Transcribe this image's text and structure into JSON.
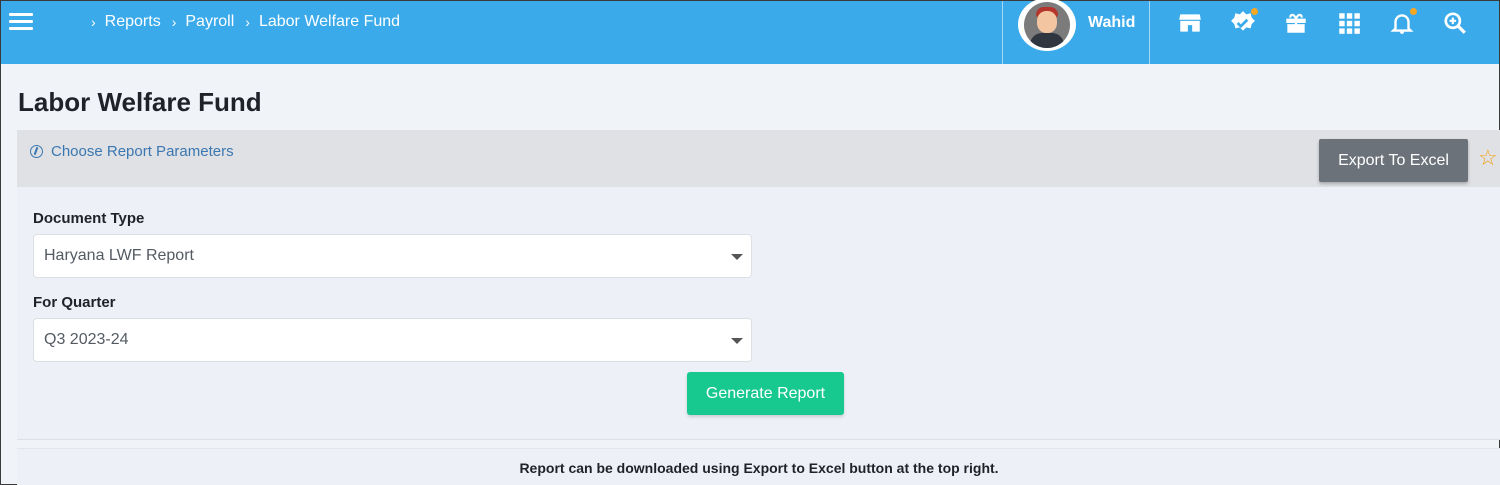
{
  "breadcrumb": {
    "items": [
      "Reports",
      "Payroll",
      "Labor Welfare Fund"
    ]
  },
  "user": {
    "name": "Wahid"
  },
  "header_icons": [
    "store-icon",
    "verified-badge-icon",
    "gift-icon",
    "apps-grid-icon",
    "bell-icon",
    "zoom-search-icon"
  ],
  "page": {
    "title": "Labor Welfare Fund"
  },
  "params": {
    "link_label": "Choose Report Parameters",
    "export_label": "Export To Excel"
  },
  "form": {
    "document_type": {
      "label": "Document Type",
      "value": "Haryana LWF Report"
    },
    "quarter": {
      "label": "For Quarter",
      "value": "Q3 2023-24"
    },
    "generate_label": "Generate Report"
  },
  "footer": {
    "note": "Report can be downloaded using Export to Excel button at the top right."
  },
  "colors": {
    "topbar": "#3aaaea",
    "export_button": "#6b727a",
    "generate_button": "#17c88f",
    "link": "#3b77b0",
    "star": "#f2a31c",
    "notification_dot": "#f5a623"
  }
}
